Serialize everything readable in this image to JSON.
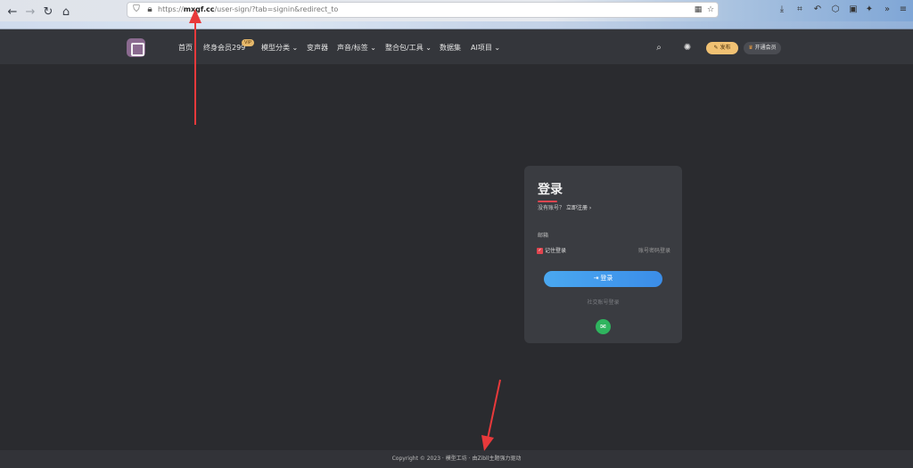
{
  "browser": {
    "back_icon": "arrow-left-icon",
    "forward_icon": "arrow-right-icon",
    "reload_icon": "reload-icon",
    "home_icon": "home-icon",
    "url_prefix": "https://",
    "url_domain": "mxgf.cc",
    "url_path": "/user-sign/?tab=signin&redirect_to"
  },
  "header": {
    "nav": [
      "首页",
      "终身会员299",
      "模型分类",
      "变声器",
      "声音/标签",
      "整合包/工具",
      "数据集",
      "AI项目"
    ],
    "vip_badge": "VIP",
    "publish_label": "发布",
    "vip_label": "开通会员"
  },
  "login": {
    "title": "登录",
    "no_account": "没有账号？",
    "register_link": "立即注册",
    "email_label": "邮箱",
    "remember_label": "记住登录",
    "password_login": "账号密码登录",
    "submit_label": "登录",
    "social_label": "社交账号登录"
  },
  "footer": {
    "text": "Copyright © 2023 · 模型工坊 · 由Zibll主题强力驱动"
  },
  "colors": {
    "accent": "#e0454f",
    "button": "#3b8de8",
    "wechat": "#2fb45e",
    "annotation": "#e8393b"
  }
}
